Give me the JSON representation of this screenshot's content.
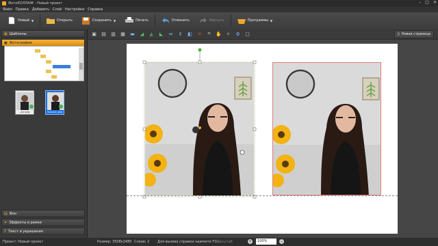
{
  "window": {
    "title": "ФотоКОЛЛАЖ - Новый проект"
  },
  "menu": [
    "Файл",
    "Правка",
    "Добавить",
    "Слой",
    "Настройки",
    "Справка"
  ],
  "toolbar": {
    "new_label": "Новый",
    "open_label": "Открыть",
    "save_label": "Сохранить",
    "print_label": "Печать",
    "undo_label": "Отменить",
    "redo_label": "Вернуть",
    "programs_label": "Программы"
  },
  "newpage_label": "Новая страница",
  "sidebar": {
    "templates": "Шаблоны",
    "photos": "Фотографии",
    "backgrounds": "Фон",
    "effects": "Эффекты и рамки",
    "text": "Текст и украшения"
  },
  "thumbnails": [
    {
      "label": "_zzz.png",
      "selected": false
    },
    {
      "label": "maxclar.jpeg",
      "selected": true
    }
  ],
  "status": {
    "project": "Проект: Новый проект",
    "size": "Размер: 3508x2480",
    "layers": "Слоев: 2",
    "hint": "Для вызова справки нажмите F1...",
    "fit": "Масштаб",
    "zoom": "100%"
  },
  "colors": {
    "accent": "#f0a62a",
    "selection": "#1f6fd6",
    "page": "#ffffff"
  }
}
